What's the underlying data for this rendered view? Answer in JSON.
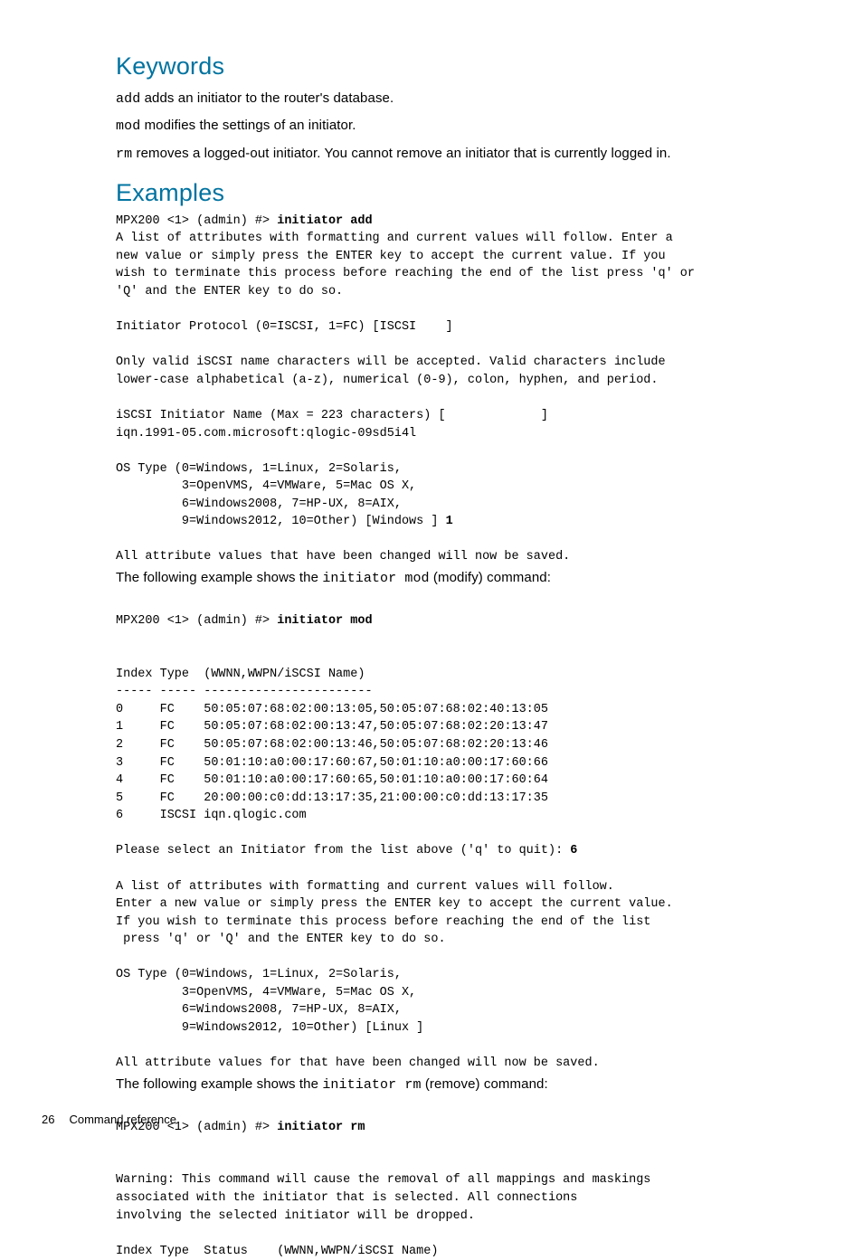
{
  "headings": {
    "keywords": "Keywords",
    "examples": "Examples"
  },
  "keywords": {
    "add_kw": "add",
    "add_desc": " adds an initiator to the router's database.",
    "mod_kw": "mod",
    "mod_desc": " modifies the settings of an initiator.",
    "rm_kw": "rm",
    "rm_desc": " removes a logged-out initiator. You cannot remove an initiator that is currently logged in."
  },
  "example1": {
    "prompt": "MPX200 <1> (admin) #> ",
    "command": "initiator add",
    "body": "\nA list of attributes with formatting and current values will follow. Enter a\nnew value or simply press the ENTER key to accept the current value. If you\nwish to terminate this process before reaching the end of the list press 'q' or\n'Q' and the ENTER key to do so.\n\nInitiator Protocol (0=ISCSI, 1=FC) [ISCSI    ]\n\nOnly valid iSCSI name characters will be accepted. Valid characters include\nlower-case alphabetical (a-z), numerical (0-9), colon, hyphen, and period.\n\niSCSI Initiator Name (Max = 223 characters) [             ]\niqn.1991-05.com.microsoft:qlogic-09sd5i4l\n\nOS Type (0=Windows, 1=Linux, 2=Solaris,\n         3=OpenVMS, 4=VMWare, 5=Mac OS X,\n         6=Windows2008, 7=HP-UX, 8=AIX,\n         9=Windows2012, 10=Other) [Windows ] ",
    "input": "1",
    "trailer": "\n\nAll attribute values that have been changed will now be saved."
  },
  "line_mod_pre": "The following example shows the ",
  "line_mod_cmd": "initiator mod",
  "line_mod_post": " (modify) command:",
  "example2": {
    "prompt": "\nMPX200 <1> (admin) #> ",
    "command": "initiator mod",
    "body": "\n\n\nIndex Type  (WWNN,WWPN/iSCSI Name)\n----- ----- -----------------------\n0     FC    50:05:07:68:02:00:13:05,50:05:07:68:02:40:13:05\n1     FC    50:05:07:68:02:00:13:47,50:05:07:68:02:20:13:47\n2     FC    50:05:07:68:02:00:13:46,50:05:07:68:02:20:13:46\n3     FC    50:01:10:a0:00:17:60:67,50:01:10:a0:00:17:60:66\n4     FC    50:01:10:a0:00:17:60:65,50:01:10:a0:00:17:60:64\n5     FC    20:00:00:c0:dd:13:17:35,21:00:00:c0:dd:13:17:35\n6     ISCSI iqn.qlogic.com\n\nPlease select an Initiator from the list above ('q' to quit): ",
    "input": "6",
    "trailer": "\n\nA list of attributes with formatting and current values will follow.\nEnter a new value or simply press the ENTER key to accept the current value.\nIf you wish to terminate this process before reaching the end of the list\n press 'q' or 'Q' and the ENTER key to do so.\n\nOS Type (0=Windows, 1=Linux, 2=Solaris,\n         3=OpenVMS, 4=VMWare, 5=Mac OS X,\n         6=Windows2008, 7=HP-UX, 8=AIX,\n         9=Windows2012, 10=Other) [Linux ]\n\nAll attribute values for that have been changed will now be saved."
  },
  "line_rm_pre": "The following example shows the ",
  "line_rm_cmd": "initiator rm",
  "line_rm_post": " (remove) command:",
  "example3": {
    "prompt": "\nMPX200 <1> (admin) #> ",
    "command": "initiator rm",
    "body": "\n\n\nWarning: This command will cause the removal of all mappings and maskings\nassociated with the initiator that is selected. All connections\ninvolving the selected initiator will be dropped.\n\nIndex Type  Status    (WWNN,WWPN/iSCSI Name)"
  },
  "footer": {
    "page": "26",
    "title": "Command reference"
  }
}
